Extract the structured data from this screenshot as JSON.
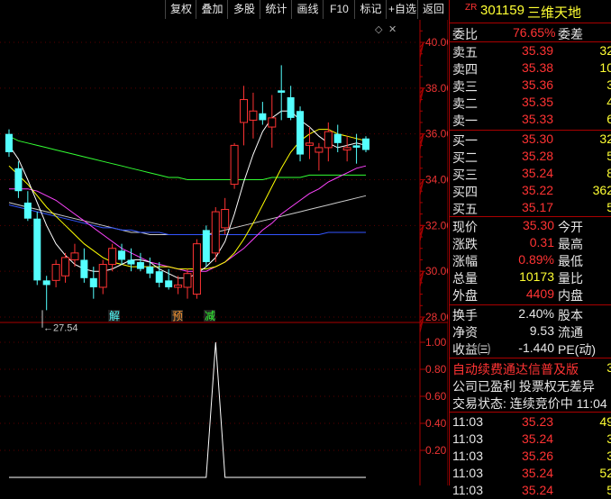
{
  "toolbar": {
    "buttons": [
      "复权",
      "叠加",
      "多股",
      "统计",
      "画线",
      "F10",
      "标记",
      "+自选",
      "返回"
    ]
  },
  "stock": {
    "badge": "ZR",
    "code": "301159",
    "name": "三维天地"
  },
  "price_axis": [
    "40.00",
    "38.00",
    "36.00",
    "34.00",
    "32.00",
    "30.00",
    "28.00"
  ],
  "indicator_axis": [
    "1.00",
    "0.80",
    "0.60",
    "0.40",
    "0.20"
  ],
  "low_marker": "27.54",
  "signals": [
    "解",
    "预",
    "减"
  ],
  "weibi": {
    "label": "委比",
    "value": "76.65%",
    "label2": "委差"
  },
  "asks": [
    {
      "label": "卖五",
      "price": "35.39",
      "vol": "32"
    },
    {
      "label": "卖四",
      "price": "35.38",
      "vol": "10"
    },
    {
      "label": "卖三",
      "price": "35.36",
      "vol": "3"
    },
    {
      "label": "卖二",
      "price": "35.35",
      "vol": "4"
    },
    {
      "label": "卖一",
      "price": "35.33",
      "vol": "6"
    }
  ],
  "bids": [
    {
      "label": "买一",
      "price": "35.30",
      "vol": "32"
    },
    {
      "label": "买二",
      "price": "35.28",
      "vol": "5"
    },
    {
      "label": "买三",
      "price": "35.24",
      "vol": "8"
    },
    {
      "label": "买四",
      "price": "35.22",
      "vol": "362"
    },
    {
      "label": "买五",
      "price": "35.17",
      "vol": "5"
    }
  ],
  "quote": [
    {
      "l": "现价",
      "v": "35.30",
      "c": "red",
      "l2": "今开"
    },
    {
      "l": "涨跌",
      "v": "0.31",
      "c": "red",
      "l2": "最高"
    },
    {
      "l": "涨幅",
      "v": "0.89%",
      "c": "red",
      "l2": "最低"
    },
    {
      "l": "总量",
      "v": "10173",
      "c": "yellow",
      "l2": "量比"
    },
    {
      "l": "外盘",
      "v": "4409",
      "c": "red",
      "l2": "内盘"
    }
  ],
  "finance": [
    {
      "l": "换手",
      "v": "2.40%",
      "l2": "股本"
    },
    {
      "l": "净资",
      "v": "9.53",
      "l2": "流通"
    },
    {
      "l": "收益㈢",
      "v": "-1.440",
      "l2": "PE(动)"
    }
  ],
  "news": {
    "line1": "自动续费通达信普及版",
    "line1_extra": "3",
    "line2": "公司已盈利 投票权无差异",
    "status": "交易状态: 连续竞价中 11:04"
  },
  "ticks": [
    {
      "t": "11:03",
      "p": "35.23",
      "v": "49"
    },
    {
      "t": "11:03",
      "p": "35.24",
      "v": "3"
    },
    {
      "t": "11:03",
      "p": "35.26",
      "v": "3"
    },
    {
      "t": "11:03",
      "p": "35.24",
      "v": "52"
    },
    {
      "t": "11:03",
      "p": "35.24",
      "v": "5"
    }
  ],
  "colors": {
    "up": "#ff3333",
    "down": "#54ffff",
    "ma5": "#ffffff",
    "ma10": "#ffff00",
    "ma20": "#ff44ff",
    "ma30": "#33ff33",
    "ma60": "#cccccc",
    "ma120": "#3355ff"
  },
  "candles": [
    {
      "o": 36.0,
      "h": 36.2,
      "l": 35.0,
      "c": 35.2
    },
    {
      "o": 34.5,
      "h": 34.8,
      "l": 33.2,
      "c": 33.5
    },
    {
      "o": 33.0,
      "h": 33.5,
      "l": 32.2,
      "c": 32.3
    },
    {
      "o": 32.3,
      "h": 32.6,
      "l": 29.4,
      "c": 29.6
    },
    {
      "o": 29.6,
      "h": 29.8,
      "l": 28.3,
      "c": 29.4
    },
    {
      "o": 29.6,
      "h": 30.5,
      "l": 29.3,
      "c": 30.3
    },
    {
      "o": 29.8,
      "h": 30.8,
      "l": 29.5,
      "c": 30.6
    },
    {
      "o": 30.5,
      "h": 31.2,
      "l": 30.2,
      "c": 30.8
    },
    {
      "o": 30.5,
      "h": 31.0,
      "l": 29.5,
      "c": 29.7
    },
    {
      "o": 29.7,
      "h": 30.2,
      "l": 28.8,
      "c": 29.3
    },
    {
      "o": 29.3,
      "h": 30.5,
      "l": 29.0,
      "c": 30.3
    },
    {
      "o": 30.3,
      "h": 31.2,
      "l": 30.0,
      "c": 31.0
    },
    {
      "o": 30.9,
      "h": 31.2,
      "l": 30.3,
      "c": 30.5
    },
    {
      "o": 30.5,
      "h": 31.0,
      "l": 30.0,
      "c": 30.3
    },
    {
      "o": 30.4,
      "h": 30.8,
      "l": 30.0,
      "c": 30.1
    },
    {
      "o": 30.2,
      "h": 30.6,
      "l": 29.7,
      "c": 29.9
    },
    {
      "o": 30.0,
      "h": 30.4,
      "l": 29.3,
      "c": 29.5
    },
    {
      "o": 29.6,
      "h": 30.1,
      "l": 29.2,
      "c": 29.3
    },
    {
      "o": 29.3,
      "h": 29.8,
      "l": 29.0,
      "c": 29.4
    },
    {
      "o": 29.3,
      "h": 30.1,
      "l": 28.8,
      "c": 29.9
    },
    {
      "o": 29.0,
      "h": 31.4,
      "l": 28.8,
      "c": 31.2
    },
    {
      "o": 31.8,
      "h": 32.0,
      "l": 30.2,
      "c": 30.4
    },
    {
      "o": 30.8,
      "h": 32.8,
      "l": 30.4,
      "c": 32.6
    },
    {
      "o": 31.9,
      "h": 33.2,
      "l": 31.6,
      "c": 32.7
    },
    {
      "o": 33.8,
      "h": 35.6,
      "l": 33.6,
      "c": 35.5
    },
    {
      "o": 36.5,
      "h": 38.1,
      "l": 35.5,
      "c": 37.5
    },
    {
      "o": 36.6,
      "h": 37.8,
      "l": 35.8,
      "c": 37.0
    },
    {
      "o": 36.9,
      "h": 37.4,
      "l": 36.4,
      "c": 36.6
    },
    {
      "o": 36.3,
      "h": 37.7,
      "l": 35.4,
      "c": 36.7
    },
    {
      "o": 37.9,
      "h": 39.0,
      "l": 36.6,
      "c": 37.8
    },
    {
      "o": 37.6,
      "h": 38.1,
      "l": 36.6,
      "c": 36.7
    },
    {
      "o": 37.0,
      "h": 37.2,
      "l": 34.8,
      "c": 35.1
    },
    {
      "o": 35.5,
      "h": 36.3,
      "l": 34.9,
      "c": 35.6
    },
    {
      "o": 35.2,
      "h": 35.6,
      "l": 34.4,
      "c": 35.4
    },
    {
      "o": 35.4,
      "h": 36.5,
      "l": 34.8,
      "c": 36.1
    },
    {
      "o": 36.0,
      "h": 36.4,
      "l": 35.2,
      "c": 35.6
    },
    {
      "o": 35.3,
      "h": 35.9,
      "l": 34.8,
      "c": 35.4
    },
    {
      "o": 35.5,
      "h": 36.0,
      "l": 34.7,
      "c": 35.4
    },
    {
      "o": 35.8,
      "h": 35.9,
      "l": 35.2,
      "c": 35.3
    }
  ],
  "ma5": [
    35.5,
    34.9,
    34.0,
    33.0,
    32.0,
    31.2,
    30.7,
    30.3,
    30.1,
    30.0,
    30.0,
    30.1,
    30.3,
    30.5,
    30.5,
    30.4,
    30.1,
    29.9,
    29.7,
    29.7,
    29.9,
    30.2,
    30.6,
    31.3,
    32.5,
    33.9,
    35.1,
    36.1,
    36.7,
    37.0,
    37.0,
    36.6,
    36.3,
    35.9,
    35.6,
    35.4,
    35.5,
    35.6,
    35.5
  ],
  "ma10": [
    34.6,
    34.2,
    33.8,
    33.3,
    32.8,
    32.4,
    32.0,
    31.6,
    31.2,
    30.9,
    30.6,
    30.4,
    30.3,
    30.2,
    30.2,
    30.2,
    30.2,
    30.2,
    30.1,
    30.1,
    30.1,
    30.1,
    30.2,
    30.4,
    30.8,
    31.4,
    32.1,
    32.9,
    33.7,
    34.5,
    35.2,
    35.7,
    36.0,
    36.2,
    36.2,
    36.0,
    35.9,
    35.8,
    35.7
  ],
  "ma20": [
    33.6,
    33.6,
    33.6,
    33.5,
    33.3,
    33.1,
    32.8,
    32.5,
    32.2,
    31.9,
    31.6,
    31.3,
    31.0,
    30.8,
    30.6,
    30.4,
    30.3,
    30.2,
    30.1,
    30.0,
    30.0,
    30.0,
    30.2,
    30.4,
    30.7,
    31.0,
    31.4,
    31.8,
    32.1,
    32.5,
    32.8,
    33.1,
    33.4,
    33.6,
    33.9,
    34.1,
    34.3,
    34.5,
    34.6
  ],
  "ma30": [
    35.9,
    35.7,
    35.6,
    35.5,
    35.4,
    35.3,
    35.2,
    35.1,
    35.0,
    34.9,
    34.8,
    34.7,
    34.6,
    34.5,
    34.4,
    34.3,
    34.2,
    34.1,
    34.1,
    34.0,
    34.0,
    34.0,
    34.0,
    34.0,
    34.0,
    34.0,
    34.0,
    34.0,
    34.1,
    34.1,
    34.1,
    34.1,
    34.2,
    34.2,
    34.2,
    34.2,
    34.2,
    34.2,
    34.2
  ],
  "ma60": [
    33.0,
    32.9,
    32.8,
    32.7,
    32.6,
    32.5,
    32.4,
    32.3,
    32.2,
    32.1,
    32.0,
    31.9,
    31.8,
    31.7,
    31.7,
    31.6,
    31.6,
    31.6,
    31.6,
    31.6,
    31.6,
    31.6,
    31.7,
    31.8,
    31.9,
    32.0,
    32.1,
    32.2,
    32.3,
    32.4,
    32.5,
    32.6,
    32.7,
    32.8,
    32.9,
    33.0,
    33.1,
    33.2,
    33.3
  ],
  "ma120": [
    32.9,
    32.8,
    32.7,
    32.6,
    32.5,
    32.4,
    32.3,
    32.2,
    32.1,
    32.0,
    31.9,
    31.9,
    31.8,
    31.8,
    31.7,
    31.7,
    31.7,
    31.6,
    31.6,
    31.6,
    31.6,
    31.6,
    31.6,
    31.6,
    31.6,
    31.6,
    31.6,
    31.6,
    31.6,
    31.6,
    31.6,
    31.6,
    31.6,
    31.6,
    31.7,
    31.7,
    31.7,
    31.7,
    31.7
  ],
  "indicator_values": [
    0,
    0,
    0,
    0,
    0,
    0,
    0,
    0,
    0,
    0,
    0,
    0,
    0,
    0,
    0,
    0,
    0,
    0,
    0,
    0,
    0,
    0,
    1.0,
    0,
    0,
    0,
    0,
    0,
    0,
    0,
    0,
    0,
    0,
    0,
    0,
    0,
    0,
    0,
    0
  ]
}
